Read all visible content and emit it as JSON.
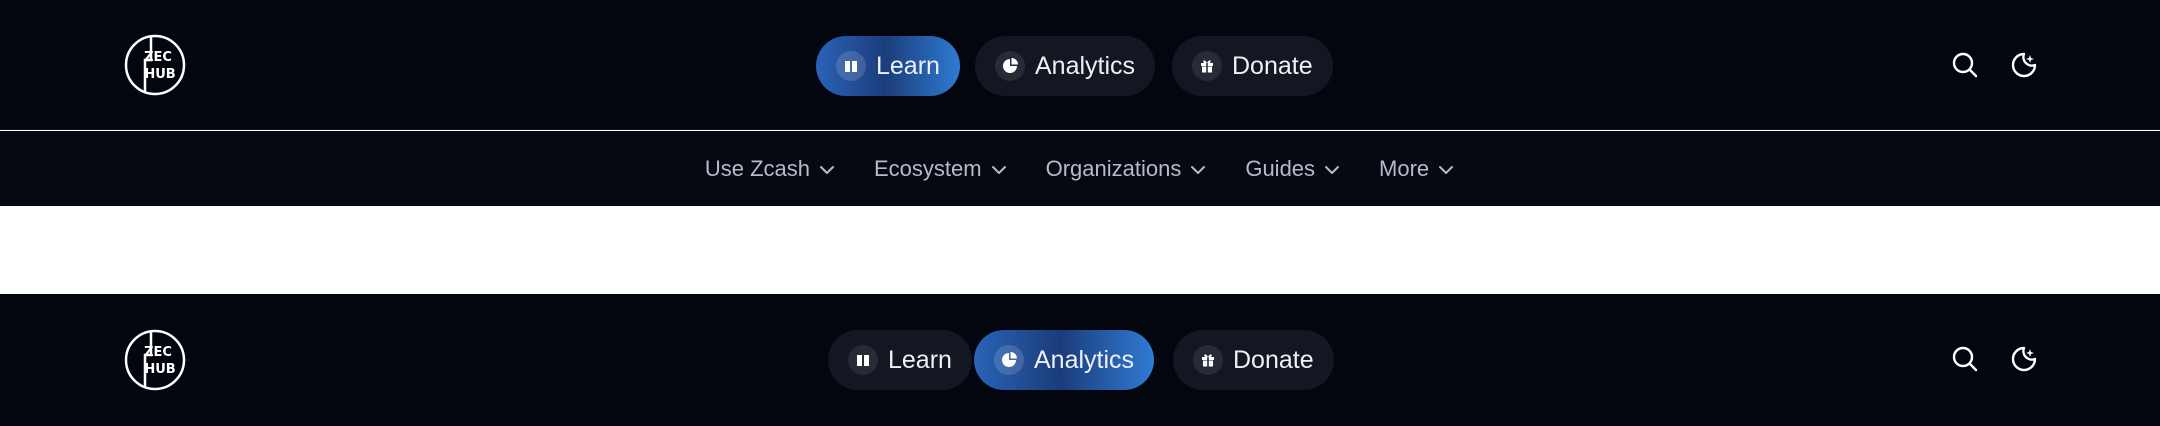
{
  "logo": {
    "line1": "ZEC",
    "line2": "HUB"
  },
  "header_state_1": {
    "active": "learn",
    "tabs": [
      {
        "key": "learn",
        "label": "Learn",
        "icon": "book-icon"
      },
      {
        "key": "analytics",
        "label": "Analytics",
        "icon": "pie-chart-icon"
      },
      {
        "key": "donate",
        "label": "Donate",
        "icon": "gift-icon"
      }
    ]
  },
  "submenu": {
    "items": [
      {
        "label": "Use Zcash",
        "icon": "chevron-down-icon"
      },
      {
        "label": "Ecosystem",
        "icon": "chevron-down-icon"
      },
      {
        "label": "Organizations",
        "icon": "chevron-down-icon"
      },
      {
        "label": "Guides",
        "icon": "chevron-down-icon"
      },
      {
        "label": "More",
        "icon": "chevron-down-icon"
      }
    ]
  },
  "header_state_2": {
    "active": "analytics",
    "tabs": [
      {
        "key": "learn",
        "label": "Learn",
        "icon": "book-icon"
      },
      {
        "key": "analytics",
        "label": "Analytics",
        "icon": "pie-chart-icon"
      },
      {
        "key": "donate",
        "label": "Donate",
        "icon": "gift-icon"
      }
    ]
  },
  "tools": {
    "search_icon": "search-icon",
    "theme_icon": "moon-icon"
  },
  "colors": {
    "header_bg": "#04060f",
    "subnav_bg": "#060812",
    "pill_bg": "#131722",
    "pill_active_start": "#2a63b8",
    "pill_active_end": "#2f7bd4",
    "text_primary": "#eef0f6",
    "text_muted": "#b6bbc8"
  }
}
